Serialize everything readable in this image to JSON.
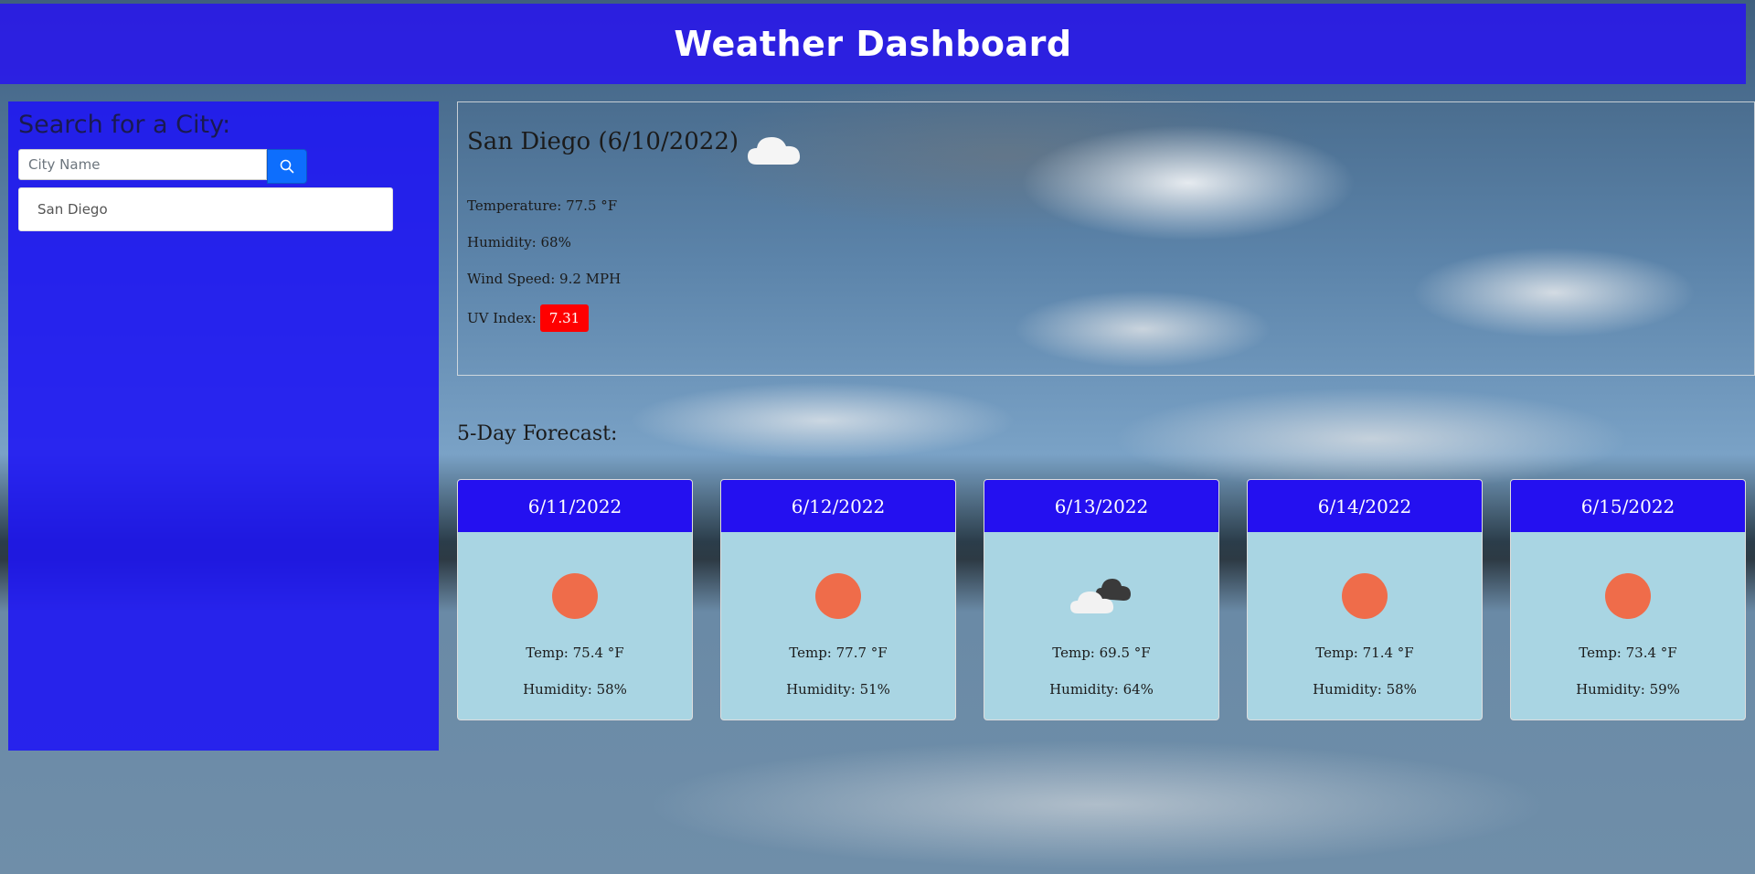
{
  "header": {
    "title": "Weather Dashboard"
  },
  "sidebar": {
    "heading": "Search for a City:",
    "search_placeholder": "City Name",
    "history": [
      "San Diego"
    ]
  },
  "current": {
    "title": "San Diego (6/10/2022)",
    "icon": "cloud-icon",
    "temperature": "Temperature: 77.5 °F",
    "humidity": "Humidity: 68%",
    "wind": "Wind Speed: 9.2 MPH",
    "uv_label": "UV Index:",
    "uv_value": "7.31",
    "uv_color": "#ff0000"
  },
  "forecast": {
    "title": "5-Day Forecast:",
    "days": [
      {
        "date": "6/11/2022",
        "icon": "sun-icon",
        "temp": "Temp: 75.4 °F",
        "humidity": "Humidity: 58%"
      },
      {
        "date": "6/12/2022",
        "icon": "sun-icon",
        "temp": "Temp: 77.7 °F",
        "humidity": "Humidity: 51%"
      },
      {
        "date": "6/13/2022",
        "icon": "clouds-icon",
        "temp": "Temp: 69.5 °F",
        "humidity": "Humidity: 64%"
      },
      {
        "date": "6/14/2022",
        "icon": "sun-icon",
        "temp": "Temp: 71.4 °F",
        "humidity": "Humidity: 58%"
      },
      {
        "date": "6/15/2022",
        "icon": "sun-icon",
        "temp": "Temp: 73.4 °F",
        "humidity": "Humidity: 59%"
      }
    ]
  },
  "colors": {
    "header_bg": "#2814f0",
    "card_header": "#2410f0",
    "card_body": "#a9d5e3",
    "sun": "#ef6c4a",
    "search_button": "#0d6efd"
  }
}
